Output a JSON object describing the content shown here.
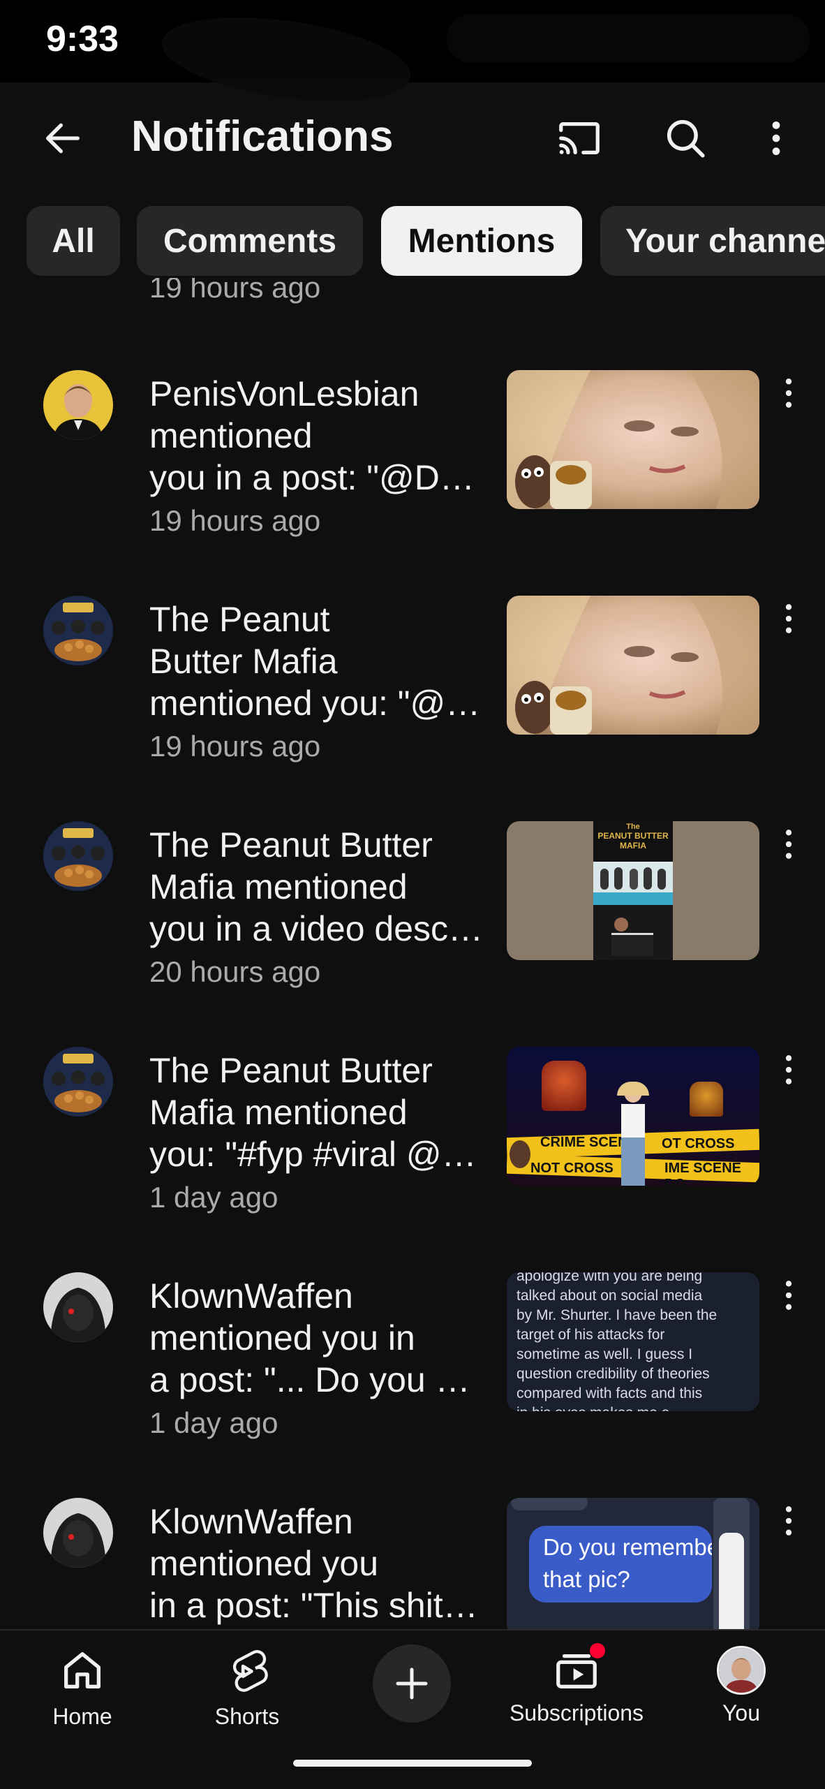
{
  "status_bar": {
    "time": "9:33"
  },
  "header": {
    "back_icon": "arrow-left-icon",
    "title": "Notifications",
    "cast_icon": "cast-icon",
    "search_icon": "search-icon",
    "more_icon": "more-vertical-icon"
  },
  "filters": [
    {
      "label": "All",
      "active": false
    },
    {
      "label": "Comments",
      "active": false
    },
    {
      "label": "Mentions",
      "active": true
    },
    {
      "label": "Your channe",
      "active": false
    }
  ],
  "previous_item_time": "19 hours ago",
  "notifications": [
    {
      "lines": [
        "PenisVonLesbian",
        "mentioned",
        "you in a post: \"@Da…"
      ],
      "time": "19 hours ago"
    },
    {
      "lines": [
        "The Peanut",
        "Butter Mafia",
        "mentioned you: \"@…"
      ],
      "time": "19 hours ago"
    },
    {
      "lines": [
        "The Peanut Butter",
        "Mafia mentioned",
        "you in a video desc…"
      ],
      "time": "20 hours ago"
    },
    {
      "lines": [
        "The Peanut Butter",
        "Mafia mentioned",
        "you: \"#fyp #viral @…"
      ],
      "time": "1 day ago"
    },
    {
      "lines": [
        "KlownWaffen",
        "mentioned you in",
        "a post: \"... Do you w…"
      ],
      "time": "1 day ago"
    },
    {
      "lines": [
        "KlownWaffen",
        "mentioned you",
        "in a post: \"This shit…"
      ],
      "time": ""
    }
  ],
  "thumbnail_text": {
    "pbm_title_small": "The",
    "pbm_title": "PEANUT BUTTER",
    "pbm_subtitle": "MAFIA",
    "crime_top_left": "CRIME SCENE",
    "crime_top_right": "OT CROSS",
    "crime_bottom_left": "NOT CROSS",
    "crime_bottom_right": "IME SCENE DO",
    "screenshot_lines": [
      "apologize with you are being",
      "talked about on social media",
      "by Mr. Shurter. I have been the",
      "target of his attacks for",
      "sometime as well. I guess I",
      "question credibility of theories",
      "compared with facts and this",
      "in his eyes makes me a"
    ],
    "chat_bubble": [
      "Do you remembe",
      "that pic?"
    ]
  },
  "bottom_nav": {
    "home": "Home",
    "shorts": "Shorts",
    "create_icon": "plus-icon",
    "subscriptions": "Subscriptions",
    "you": "You"
  },
  "colors": {
    "background": "#0f0f0f",
    "chip": "#272727",
    "chip_active": "#f1f1f1",
    "secondary_text": "#aaaaaa",
    "badge": "#ff0033"
  }
}
